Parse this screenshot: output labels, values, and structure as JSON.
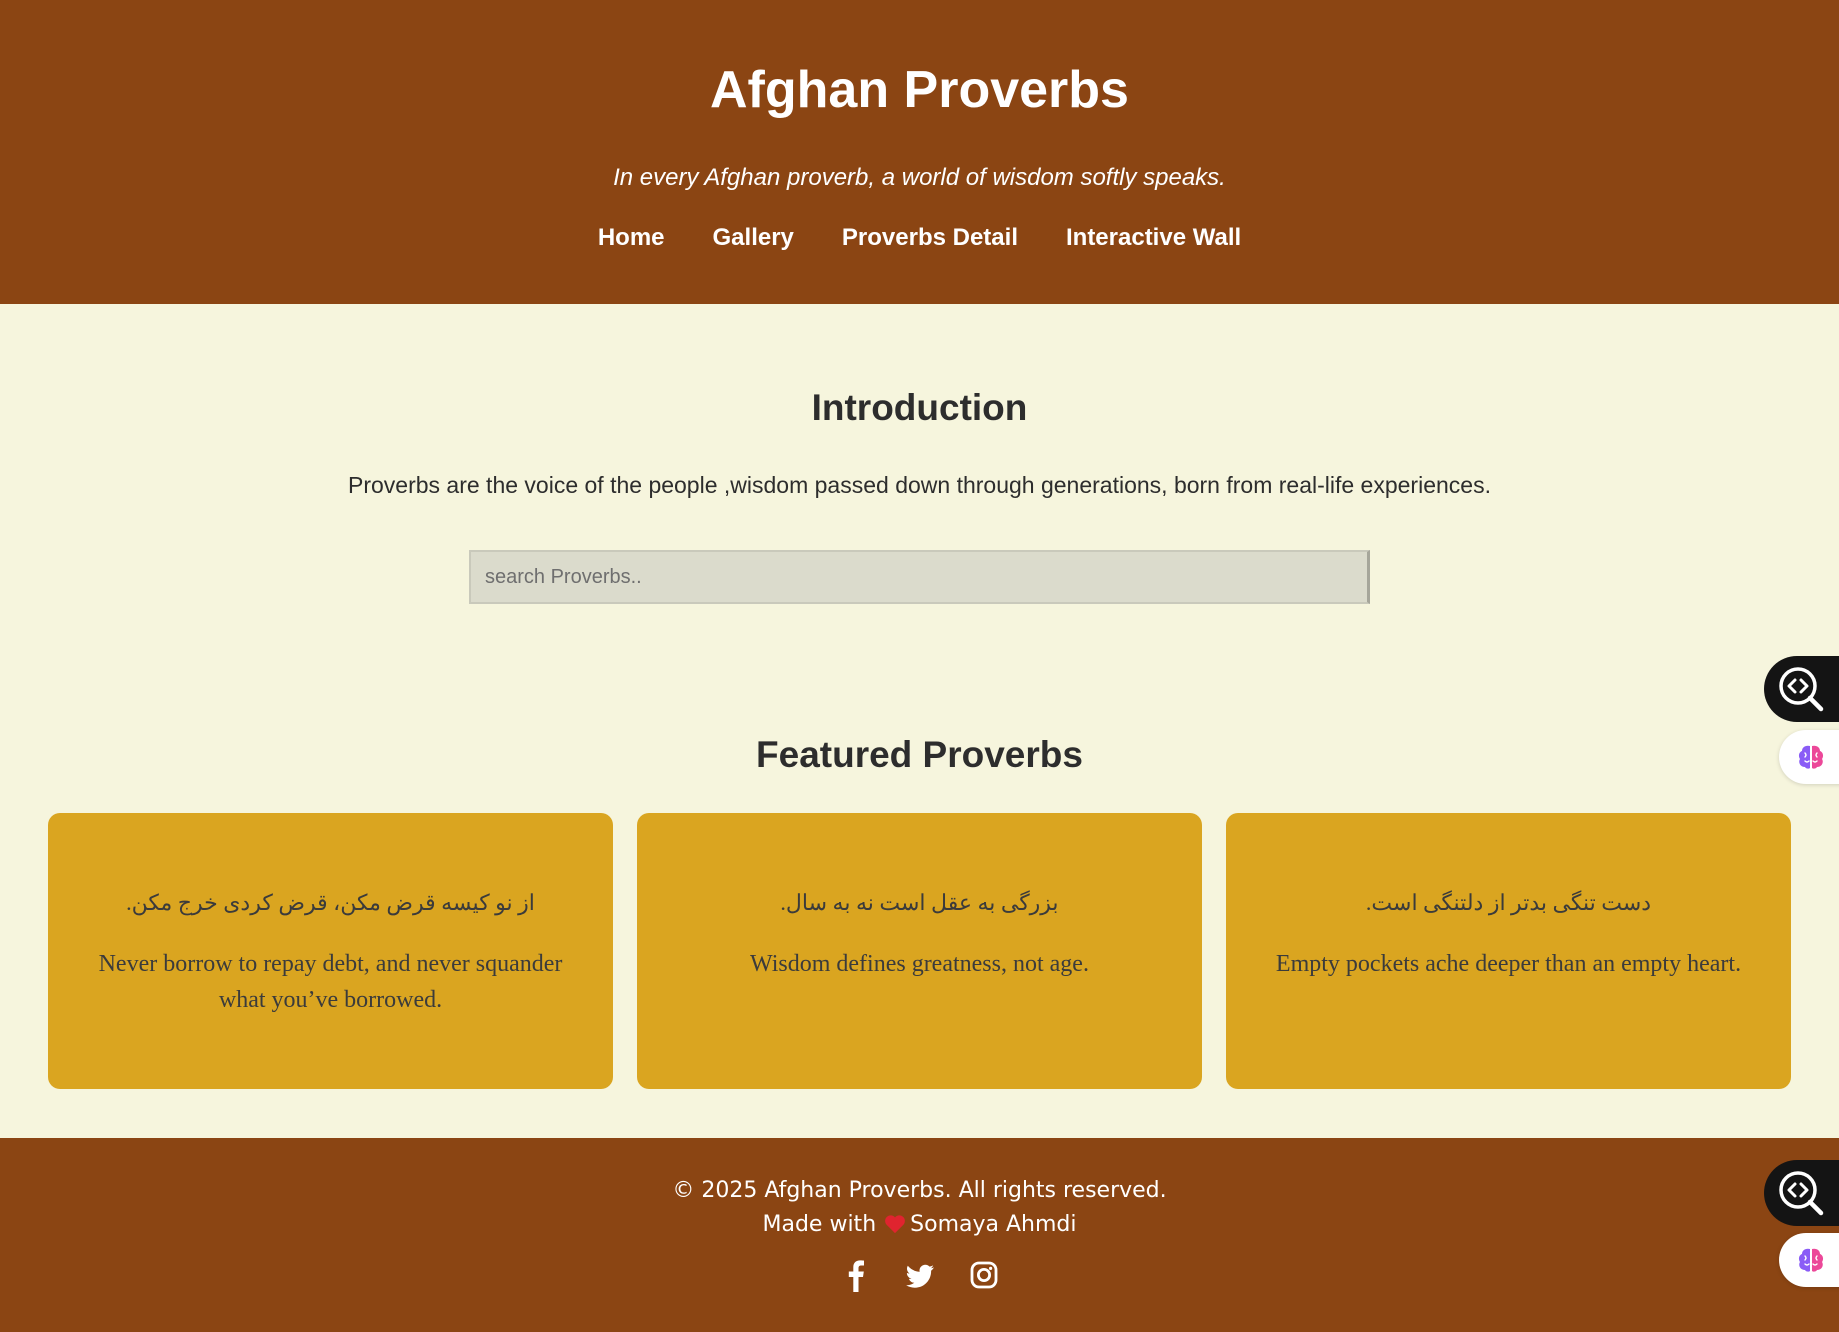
{
  "header": {
    "title": "Afghan Proverbs",
    "tagline": "In every Afghan proverb, a world of wisdom softly speaks.",
    "nav": [
      {
        "label": "Home"
      },
      {
        "label": "Gallery"
      },
      {
        "label": "Proverbs Detail"
      },
      {
        "label": "Interactive Wall"
      }
    ]
  },
  "intro": {
    "title": "Introduction",
    "text": "Proverbs are the voice of the people ,wisdom passed down through generations, born from real-life experiences.",
    "search_placeholder": "search Proverbs.."
  },
  "featured": {
    "title": "Featured Proverbs",
    "cards": [
      {
        "dari": "از نو کیسه قرض مکن، قرض کردی خرج مکن.",
        "english": "Never borrow to repay debt, and never squander what you’ve borrowed."
      },
      {
        "dari": "بزرگی به عقل است نه به سال.",
        "english": "Wisdom defines greatness, not age."
      },
      {
        "dari": "دست تنگی بدتر از دلتنگی است.",
        "english": "Empty pockets ache deeper than an empty heart."
      }
    ]
  },
  "footer": {
    "copyright": "© 2025 Afghan Proverbs. All rights reserved.",
    "made_with": "Made with",
    "author": "Somaya Ahmdi",
    "socials": [
      {
        "icon": "facebook-icon"
      },
      {
        "icon": "twitter-icon"
      },
      {
        "icon": "instagram-icon"
      }
    ]
  },
  "colors": {
    "header_bg": "#8b4513",
    "page_bg": "#f6f5dd",
    "card_bg": "#daa520",
    "heart": "#e0242f"
  }
}
